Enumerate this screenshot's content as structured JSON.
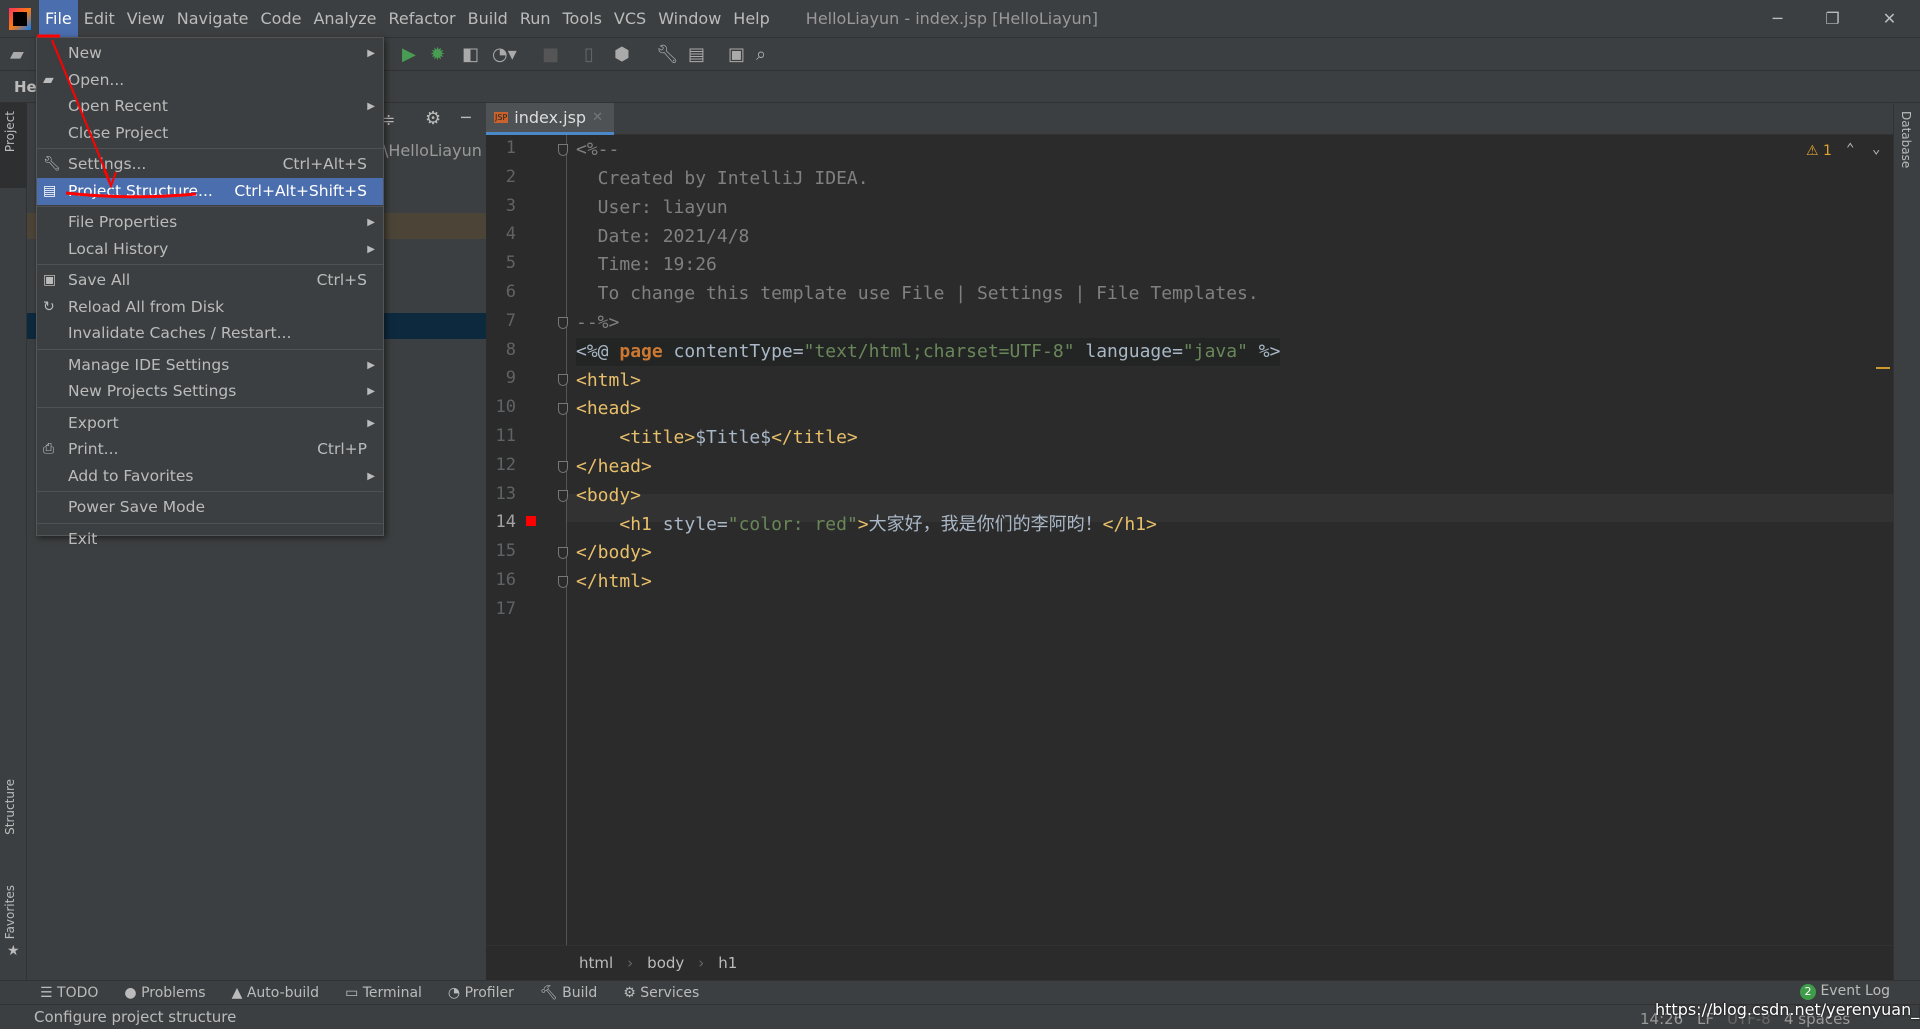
{
  "titlebar": {
    "menus": [
      "File",
      "Edit",
      "View",
      "Navigate",
      "Code",
      "Analyze",
      "Refactor",
      "Build",
      "Run",
      "Tools",
      "VCS",
      "Window",
      "Help"
    ],
    "title": "HelloLiayun - index.jsp [HelloLiayun]"
  },
  "navbar": {
    "project": "He"
  },
  "project_panel": {
    "path": "\\HelloLiayun"
  },
  "left_stripe": {
    "project": "Project",
    "structure": "Structure",
    "favorites": "Favorites"
  },
  "right_stripe": {
    "database": "Database"
  },
  "file_menu": {
    "items": [
      {
        "label": "New",
        "arrow": true
      },
      {
        "label": "Open...",
        "icon": "folder-open"
      },
      {
        "label": "Open Recent",
        "arrow": true
      },
      {
        "label": "Close Project"
      },
      {
        "label": "Settings...",
        "shortcut": "Ctrl+Alt+S",
        "icon": "wrench"
      },
      {
        "label": "Project Structure...",
        "shortcut": "Ctrl+Alt+Shift+S",
        "icon": "project-structure",
        "selected": true
      },
      {
        "label": "File Properties",
        "arrow": true
      },
      {
        "label": "Local History",
        "arrow": true
      },
      {
        "label": "Save All",
        "shortcut": "Ctrl+S",
        "icon": "save"
      },
      {
        "label": "Reload All from Disk",
        "icon": "reload"
      },
      {
        "label": "Invalidate Caches / Restart..."
      },
      {
        "label": "Manage IDE Settings",
        "arrow": true
      },
      {
        "label": "New Projects Settings",
        "arrow": true
      },
      {
        "label": "Export",
        "arrow": true
      },
      {
        "label": "Print...",
        "shortcut": "Ctrl+P",
        "icon": "printer"
      },
      {
        "label": "Add to Favorites",
        "arrow": true
      },
      {
        "label": "Power Save Mode"
      },
      {
        "label": "Exit"
      }
    ]
  },
  "editor": {
    "tab": "index.jsp",
    "warnings": "1",
    "line_numbers": [
      "1",
      "2",
      "3",
      "4",
      "5",
      "6",
      "7",
      "8",
      "9",
      "10",
      "11",
      "12",
      "13",
      "14",
      "15",
      "16",
      "17"
    ],
    "current_line": "14"
  },
  "breadcrumb": [
    "html",
    "body",
    "h1"
  ],
  "bottom_tools": [
    "TODO",
    "Problems",
    "Auto-build",
    "Terminal",
    "Profiler",
    "Build",
    "Services"
  ],
  "event_log": {
    "count": "2",
    "label": "Event Log"
  },
  "status": {
    "message": "Configure project structure",
    "position": "14:26",
    "line_sep": "LF",
    "encoding": "UTF-8",
    "indent": "4 spaces",
    "watermark": "https://blog.csdn.net/yerenyuan_pku"
  },
  "colors": {
    "selection": "#4b6eaf",
    "editor_bg": "#2b2b2b",
    "annotation": "#ff0000"
  }
}
